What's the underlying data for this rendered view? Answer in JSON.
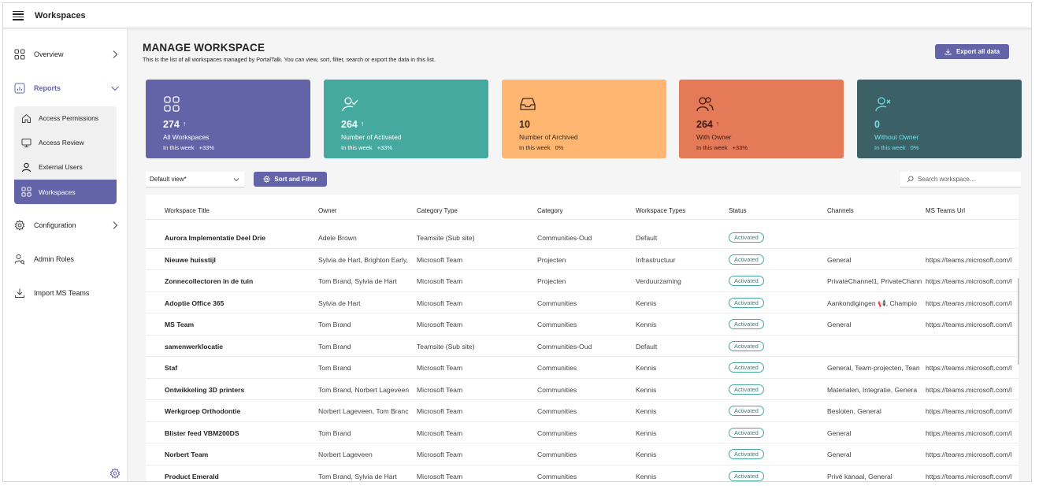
{
  "app": {
    "title": "Workspaces"
  },
  "sidebar": {
    "items": [
      {
        "label": "Overview",
        "icon": "grid-icon"
      },
      {
        "label": "Reports",
        "icon": "chart-icon"
      },
      {
        "label": "Configuration",
        "icon": "gear-icon"
      },
      {
        "label": "Admin Roles",
        "icon": "person-key-icon"
      },
      {
        "label": "Import MS Teams",
        "icon": "download-icon"
      }
    ],
    "sub_items": [
      {
        "label": "Access Permissions",
        "icon": "home-icon"
      },
      {
        "label": "Access Review",
        "icon": "monitor-icon"
      },
      {
        "label": "External Users",
        "icon": "person-icon"
      },
      {
        "label": "Workspaces",
        "icon": "grid-icon"
      }
    ]
  },
  "header": {
    "title": "MANAGE WORKSPACE",
    "subtitle": "This is the list of all workspaces managed by PortalTalk. You can view, sort, filter, search or export the data in this list.",
    "export_label": "Export all data"
  },
  "cards": [
    {
      "value": "274",
      "arrow": "↑",
      "label": "All Workspaces",
      "week": "In this week",
      "change": "+33%",
      "color": "#6264a7"
    },
    {
      "value": "264",
      "arrow": "↑",
      "label": "Number of Activated",
      "week": "In this week",
      "change": "+33%",
      "color": "#46a9a0"
    },
    {
      "value": "10",
      "arrow": "",
      "label": "Number of Archived",
      "week": "In this week",
      "change": "0%",
      "color": "#ffb670"
    },
    {
      "value": "264",
      "arrow": "↑",
      "label": "With Owner",
      "week": "In this week",
      "change": "+33%",
      "color": "#e57a58"
    },
    {
      "value": "0",
      "arrow": "",
      "label": "Without Owner",
      "week": "In this week",
      "change": "0%",
      "color": "#3b6167"
    }
  ],
  "toolbar": {
    "view_label": "Default view*",
    "sort_label": "Sort and Filter",
    "search_placeholder": "Search workspace..."
  },
  "table": {
    "columns": [
      "Workspace Title",
      "Owner",
      "Category Type",
      "Category",
      "Workspace Types",
      "Status",
      "Channels",
      "MS Teams Url"
    ],
    "rows": [
      [
        "Aurora Implementatie Deel Drie",
        "Adele Brown",
        "Teamsite (Sub site)",
        "Communities-Oud",
        "Default",
        "Activated",
        "",
        ""
      ],
      [
        "Nieuwe huisstijl",
        "Sylvia de Hart, Brighton Early,",
        "Microsoft Team",
        "Projecten",
        "Infrastructuur",
        "Activated",
        "General",
        "https://teams.microsoft.com/l"
      ],
      [
        "Zonnecollectoren in de tuin",
        "Tom Brand, Sylvia de Hart",
        "Microsoft Team",
        "Projecten",
        "Verduurzaming",
        "Activated",
        "PrivateChannel1, PrivateChann",
        "https://teams.microsoft.com/l"
      ],
      [
        "Adoptie Office 365",
        "Sylvia de Hart",
        "Microsoft Team",
        "Communities",
        "Kennis",
        "Activated",
        "Aankondigingen 📢, Champio",
        "https://teams.microsoft.com/l"
      ],
      [
        "MS Team",
        "Tom Brand",
        "Microsoft Team",
        "Communities",
        "Kennis",
        "Activated",
        "General",
        "https://teams.microsoft.com/l"
      ],
      [
        "samenwerklocatie",
        "Tom Brand",
        "Teamsite (Sub site)",
        "Communities-Oud",
        "Default",
        "Activated",
        "",
        ""
      ],
      [
        "Staf",
        "Tom Brand",
        "Microsoft Team",
        "Communities",
        "Kennis",
        "Activated",
        "General, Team-projecten, Tean",
        "https://teams.microsoft.com/l"
      ],
      [
        "Ontwikkeling 3D printers",
        "Tom Brand, Norbert Lageveen",
        "Microsoft Team",
        "Communities",
        "Kennis",
        "Activated",
        "Materialen, Integratie, Genera",
        "https://teams.microsoft.com/l"
      ],
      [
        "Werkgroep Orthodontie",
        "Norbert Lageveen, Tom Branc",
        "Microsoft Team",
        "Communities",
        "Kennis",
        "Activated",
        "Besloten, General",
        "https://teams.microsoft.com/l"
      ],
      [
        "Blister feed VBM200DS",
        "Tom Brand",
        "Microsoft Team",
        "Communities",
        "Kennis",
        "Activated",
        "General",
        "https://teams.microsoft.com/l"
      ],
      [
        "Norbert Team",
        "Norbert Lageveen",
        "Microsoft Team",
        "Communities",
        "Kennis",
        "Activated",
        "General",
        "https://teams.microsoft.com/l"
      ],
      [
        "Product Emerald",
        "Tom Brand, Sylvia de Hart",
        "Microsoft Team",
        "Communities",
        "Kennis",
        "Activated",
        "Privé kanaal, General",
        "https://teams.microsoft.com/l"
      ]
    ]
  }
}
